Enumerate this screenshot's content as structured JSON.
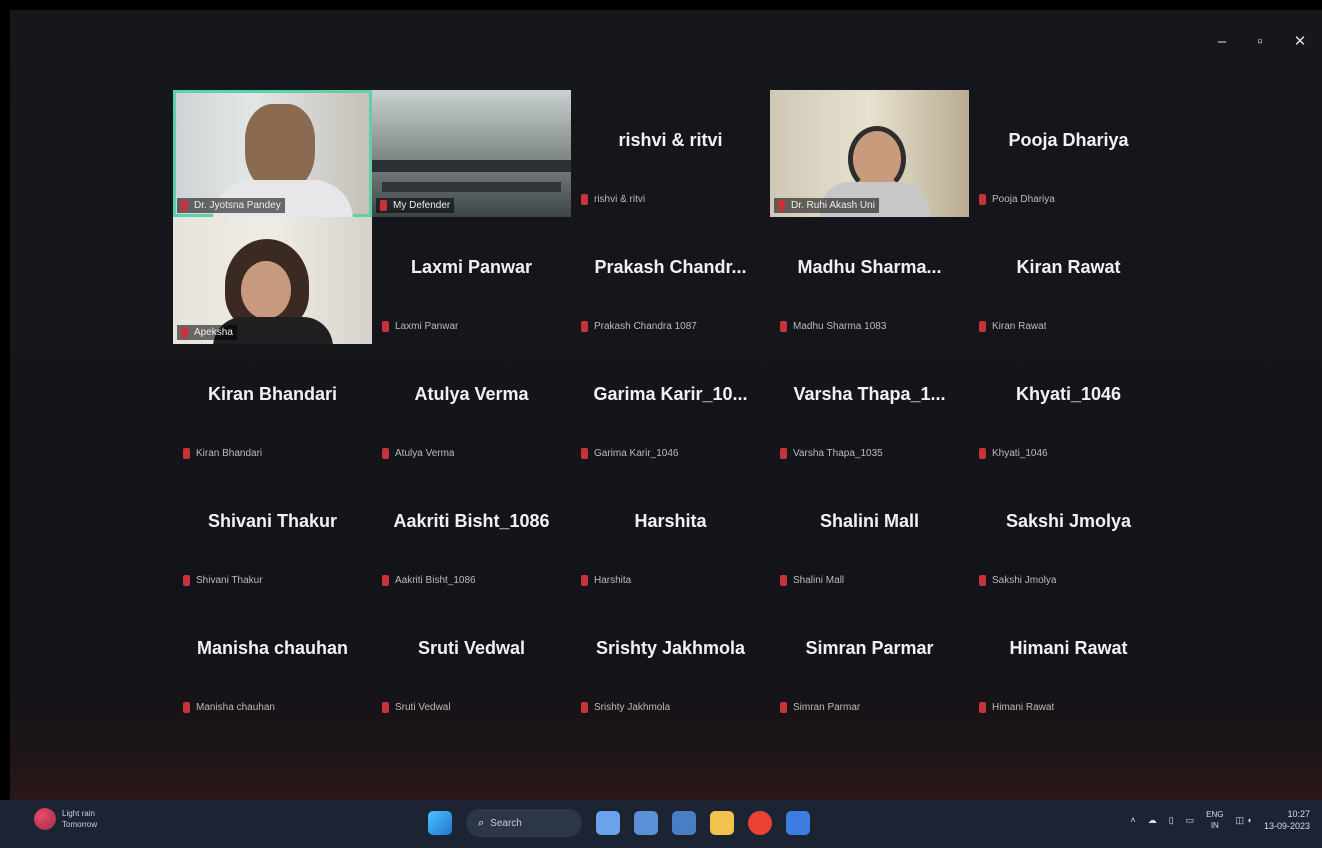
{
  "window_controls": {
    "minimize": "–",
    "maximize": "▫",
    "close": "✕"
  },
  "participants": [
    {
      "kind": "video",
      "active": true,
      "label": "Dr. Jyotsna Pandey",
      "scene": "vid1"
    },
    {
      "kind": "video",
      "active": false,
      "label": "My Defender",
      "scene": "vid2"
    },
    {
      "kind": "avatar",
      "name": "rishvi & ritvi",
      "label": "rishvi & ritvi"
    },
    {
      "kind": "video",
      "active": false,
      "label": "Dr. Ruhi Akash Uni",
      "scene": "vid3"
    },
    {
      "kind": "avatar",
      "name": "Pooja Dhariya",
      "label": "Pooja Dhariya"
    },
    {
      "kind": "video",
      "active": false,
      "label": "Apeksha",
      "scene": "vid4"
    },
    {
      "kind": "avatar",
      "name": "Laxmi Panwar",
      "label": "Laxmi Panwar"
    },
    {
      "kind": "avatar",
      "name": "Prakash Chandr...",
      "label": "Prakash Chandra 1087"
    },
    {
      "kind": "avatar",
      "name": "Madhu Sharma...",
      "label": "Madhu Sharma 1083"
    },
    {
      "kind": "avatar",
      "name": "Kiran Rawat",
      "label": "Kiran Rawat"
    },
    {
      "kind": "avatar",
      "name": "Kiran Bhandari",
      "label": "Kiran Bhandari"
    },
    {
      "kind": "avatar",
      "name": "Atulya Verma",
      "label": "Atulya Verma"
    },
    {
      "kind": "avatar",
      "name": "Garima Karir_10...",
      "label": "Garima Karir_1046"
    },
    {
      "kind": "avatar",
      "name": "Varsha Thapa_1...",
      "label": "Varsha Thapa_1035"
    },
    {
      "kind": "avatar",
      "name": "Khyati_1046",
      "label": "Khyati_1046"
    },
    {
      "kind": "avatar",
      "name": "Shivani Thakur",
      "label": "Shivani Thakur"
    },
    {
      "kind": "avatar",
      "name": "Aakriti Bisht_1086",
      "label": "Aakriti Bisht_1086"
    },
    {
      "kind": "avatar",
      "name": "Harshita",
      "label": "Harshita"
    },
    {
      "kind": "avatar",
      "name": "Shalini Mall",
      "label": "Shalini Mall"
    },
    {
      "kind": "avatar",
      "name": "Sakshi Jmolya",
      "label": "Sakshi Jmolya"
    },
    {
      "kind": "avatar",
      "name": "Manisha chauhan",
      "label": "Manisha chauhan"
    },
    {
      "kind": "avatar",
      "name": "Sruti Vedwal",
      "label": "Sruti Vedwal"
    },
    {
      "kind": "avatar",
      "name": "Srishty Jakhmola",
      "label": "Srishty Jakhmola"
    },
    {
      "kind": "avatar",
      "name": "Simran Parmar",
      "label": "Simran Parmar"
    },
    {
      "kind": "avatar",
      "name": "Himani Rawat",
      "label": "Himani Rawat"
    }
  ],
  "taskbar": {
    "weather_line1": "Light rain",
    "weather_line2": "Tomorrow",
    "search_placeholder": "Search",
    "lang_line1": "ENG",
    "lang_line2": "IN",
    "time": "10:27",
    "date": "13-09-2023",
    "app_colors": [
      "#6aa3e8",
      "#5b8fd6",
      "#4a7ec4",
      "#f2c14e",
      "#ea4335",
      "#3d7be0"
    ]
  }
}
